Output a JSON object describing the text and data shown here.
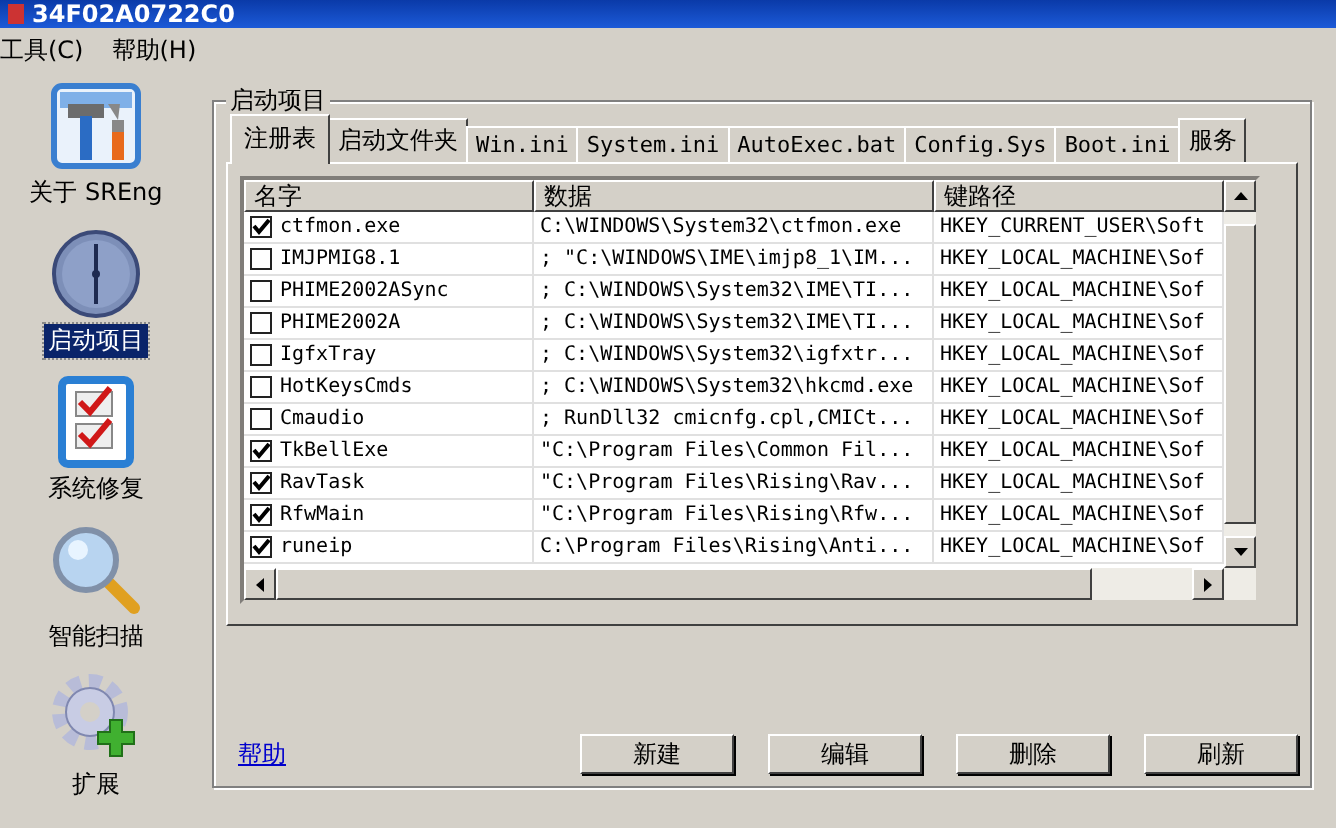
{
  "window": {
    "title": "34F02A0722C0"
  },
  "menu": [
    "工具(C)",
    "帮助(H)"
  ],
  "sidebar": {
    "items": [
      {
        "label": "关于 SREng",
        "selected": false
      },
      {
        "label": "启动项目",
        "selected": true
      },
      {
        "label": "系统修复",
        "selected": false
      },
      {
        "label": "智能扫描",
        "selected": false
      },
      {
        "label": "扩展",
        "selected": false
      }
    ]
  },
  "group": {
    "title": "启动项目"
  },
  "tabs": [
    {
      "label": "注册表",
      "selected": true
    },
    {
      "label": "启动文件夹",
      "selected": false
    },
    {
      "label": "Win.ini",
      "selected": false
    },
    {
      "label": "System.ini",
      "selected": false
    },
    {
      "label": "AutoExec.bat",
      "selected": false
    },
    {
      "label": "Config.Sys",
      "selected": false
    },
    {
      "label": "Boot.ini",
      "selected": false
    },
    {
      "label": "服务",
      "selected": false
    }
  ],
  "table": {
    "columns": [
      "名字",
      "数据",
      "键路径"
    ],
    "rows": [
      {
        "checked": true,
        "name": "ctfmon.exe",
        "data": "C:\\WINDOWS\\System32\\ctfmon.exe",
        "key": "HKEY_CURRENT_USER\\Soft"
      },
      {
        "checked": false,
        "name": "IMJPMIG8.1",
        "data": "; \"C:\\WINDOWS\\IME\\imjp8_1\\IM...",
        "key": "HKEY_LOCAL_MACHINE\\Sof"
      },
      {
        "checked": false,
        "name": "PHIME2002ASync",
        "data": "; C:\\WINDOWS\\System32\\IME\\TI...",
        "key": "HKEY_LOCAL_MACHINE\\Sof"
      },
      {
        "checked": false,
        "name": "PHIME2002A",
        "data": "; C:\\WINDOWS\\System32\\IME\\TI...",
        "key": "HKEY_LOCAL_MACHINE\\Sof"
      },
      {
        "checked": false,
        "name": "IgfxTray",
        "data": "; C:\\WINDOWS\\System32\\igfxtr...",
        "key": "HKEY_LOCAL_MACHINE\\Sof"
      },
      {
        "checked": false,
        "name": "HotKeysCmds",
        "data": "; C:\\WINDOWS\\System32\\hkcmd.exe",
        "key": "HKEY_LOCAL_MACHINE\\Sof"
      },
      {
        "checked": false,
        "name": "Cmaudio",
        "data": "; RunDll32 cmicnfg.cpl,CMICt...",
        "key": "HKEY_LOCAL_MACHINE\\Sof"
      },
      {
        "checked": true,
        "name": "TkBellExe",
        "data": "\"C:\\Program Files\\Common Fil...",
        "key": "HKEY_LOCAL_MACHINE\\Sof"
      },
      {
        "checked": true,
        "name": "RavTask",
        "data": "\"C:\\Program Files\\Rising\\Rav...",
        "key": "HKEY_LOCAL_MACHINE\\Sof"
      },
      {
        "checked": true,
        "name": "RfwMain",
        "data": "\"C:\\Program Files\\Rising\\Rfw...",
        "key": "HKEY_LOCAL_MACHINE\\Sof"
      },
      {
        "checked": true,
        "name": "runeip",
        "data": "C:\\Program Files\\Rising\\Anti...",
        "key": "HKEY_LOCAL_MACHINE\\Sof"
      }
    ]
  },
  "help_link": "帮助",
  "buttons": [
    "新建",
    "编辑",
    "删除",
    "刷新"
  ]
}
